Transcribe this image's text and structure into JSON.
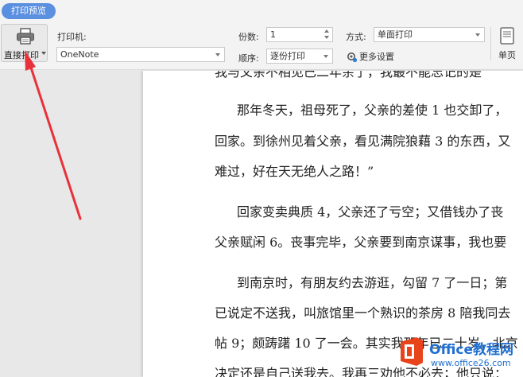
{
  "toolbar": {
    "preview_tab": "打印预览",
    "direct_print_label": "直接打印",
    "printer_label": "打印机:",
    "printer_value": "OneNote",
    "copies_label": "份数:",
    "copies_value": "1",
    "order_label": "顺序:",
    "order_value": "逐份打印",
    "mode_label": "方式:",
    "mode_value": "单面打印",
    "more_settings_label": "更多设置",
    "single_page_label": "单页"
  },
  "document": {
    "lines": [
      "我与父亲不相见已二年余了，我最不能忘记的是",
      "那年冬天，祖母死了，父亲的差使 1 也交卸了，",
      "回家。到徐州见着父亲，看见满院狼藉 3 的东西，又",
      "难过，好在天无绝人之路！”",
      "回家变卖典质 4，父亲还了亏空；又借钱办了丧",
      "父亲赋闲 6。丧事完毕，父亲要到南京谋事，我也要",
      "到南京时，有朋友约去游逛，勾留 7 了一日；第",
      "已说定不送我，叫旅馆里一个熟识的茶房 8 陪我同去",
      "帖 9；颇踌躇 10 了一会。其实我那年已二十岁，北京",
      "决定还是自己送我去。我再三劝他不必去；他只说："
    ]
  },
  "watermark": {
    "title": "Office教程网",
    "url": "www.office26.com"
  },
  "colors": {
    "accent": "#5b8fe0",
    "arrow": "#e8313a",
    "watermark": "#1f6fd1",
    "logo": "#e8431a"
  }
}
